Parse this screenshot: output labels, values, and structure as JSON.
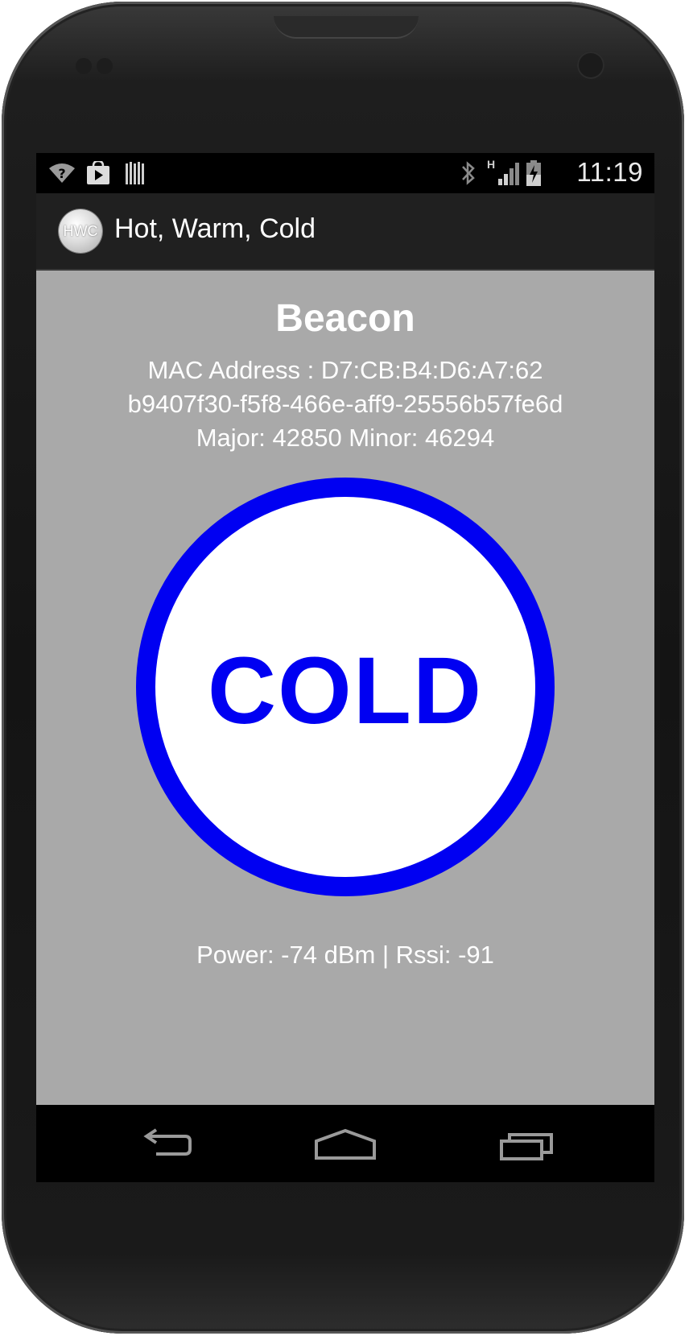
{
  "status_bar": {
    "time": "11:19",
    "network_type": "H",
    "left_icons": [
      "wifi-question-icon",
      "play-store-icon",
      "barcode-icon"
    ],
    "right_icons": [
      "bluetooth-icon",
      "signal-icon",
      "battery-charging-icon"
    ]
  },
  "action_bar": {
    "app_icon_text": "HWC",
    "title": "Hot, Warm, Cold"
  },
  "beacon": {
    "heading": "Beacon",
    "mac_line": "MAC Address : D7:CB:B4:D6:A7:62",
    "uuid": "b9407f30-f5f8-466e-aff9-25556b57fe6d",
    "major_minor": "Major: 42850   Minor: 46294"
  },
  "proximity": {
    "label": "COLD",
    "color": "#0000f2"
  },
  "signal": {
    "power_rssi": "Power: -74 dBm |  Rssi: -91"
  },
  "nav_bar": {
    "buttons": [
      "back-icon",
      "home-icon",
      "recent-apps-icon"
    ]
  },
  "colors": {
    "screen_background": "#a9a9a9",
    "action_bar": "#202020",
    "status_bar": "#000000",
    "ring_fill": "#ffffff"
  }
}
